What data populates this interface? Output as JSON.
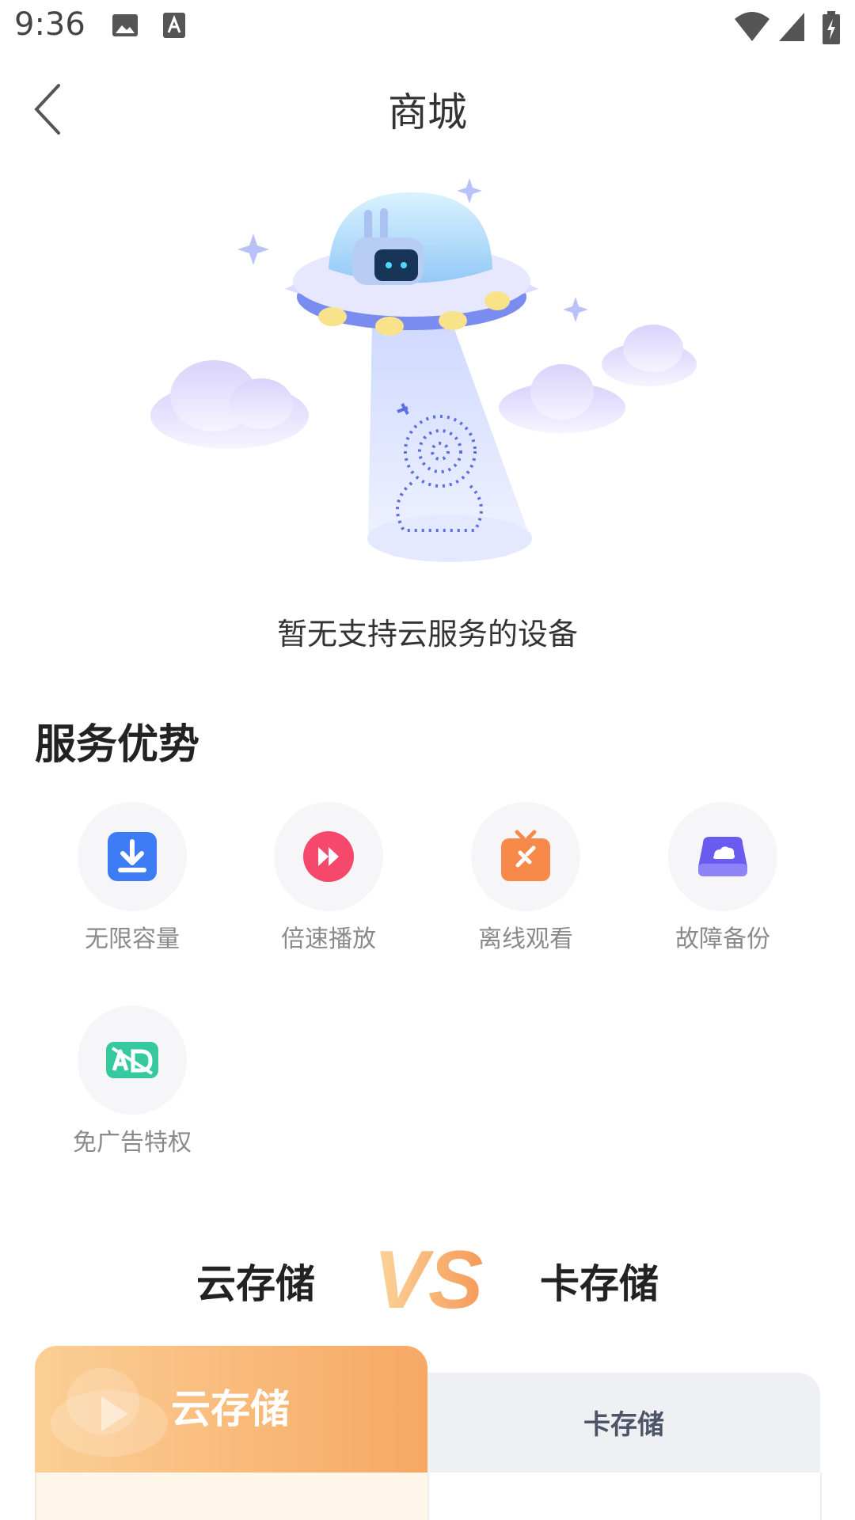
{
  "status_bar": {
    "time": "9:36",
    "icons": [
      "image-icon",
      "text-a-icon",
      "wifi-icon",
      "signal-icon",
      "battery-charging-icon"
    ]
  },
  "header": {
    "title": "商城",
    "back_icon": "chevron-left-icon"
  },
  "empty_state": {
    "illustration": "ufo-camera-illustration",
    "message": "暂无支持云服务的设备"
  },
  "advantages": {
    "title": "服务优势",
    "items": [
      {
        "label": "无限容量",
        "icon": "download-icon",
        "color": "#3d7cf5"
      },
      {
        "label": "倍速播放",
        "icon": "fast-forward-icon",
        "color": "#f5486a"
      },
      {
        "label": "离线观看",
        "icon": "offline-tv-icon",
        "color": "#f78a4a"
      },
      {
        "label": "故障备份",
        "icon": "cloud-drive-icon",
        "color": "#6a5cf0"
      },
      {
        "label": "免广告特权",
        "icon": "no-ad-icon",
        "color": "#36c9a0"
      }
    ]
  },
  "comparison": {
    "left": "云存储",
    "vs": "VS",
    "right": "卡存储",
    "tabs": [
      {
        "label": "云存储",
        "active": true
      },
      {
        "label": "卡存储",
        "active": false
      }
    ],
    "accent": "#f7a864"
  }
}
